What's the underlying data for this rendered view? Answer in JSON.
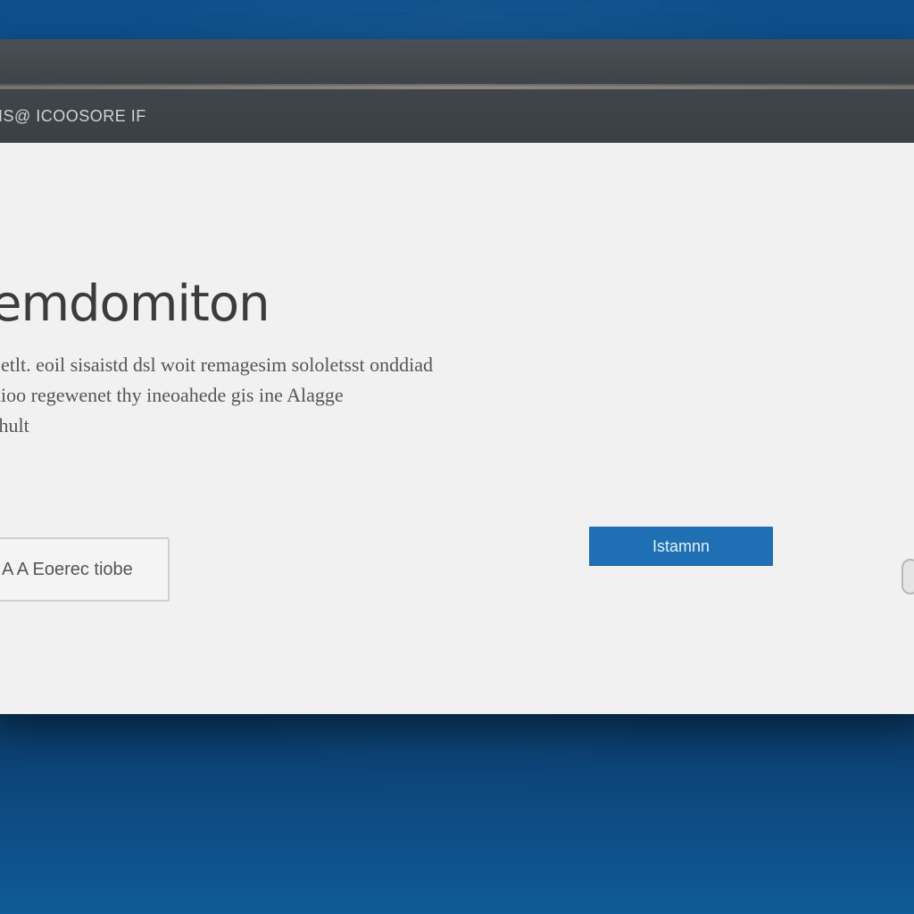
{
  "window": {
    "title": "IS@ ICOOSORE IF"
  },
  "main": {
    "heading": "emdomiton",
    "body_lines": [
      "petlt. eoil sisaistd dsl woit remagesim sololetsst onddiad",
      "dioo regewenet thy ineoahede gis ine Alagge",
      "shult"
    ]
  },
  "actions": {
    "secondary_label": "A A Eoerec tiobe",
    "primary_label": "Istamnn"
  },
  "colors": {
    "desktop_blue": "#0e5a98",
    "title_bar": "#3f454b",
    "primary_button": "#1f6fb5",
    "content_bg": "#f1f1f1"
  }
}
